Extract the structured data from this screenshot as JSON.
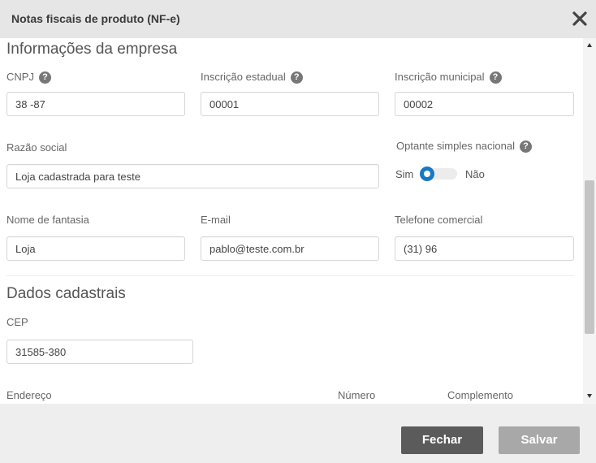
{
  "dialog": {
    "title": "Notas fiscais de produto (NF-e)",
    "close_icon": "close-icon"
  },
  "company_section": {
    "title": "Informações da empresa",
    "cnpj": {
      "label": "CNPJ",
      "value": "38                    -87"
    },
    "inscricao_estadual": {
      "label": "Inscrição estadual",
      "value": "00001"
    },
    "inscricao_municipal": {
      "label": "Inscrição municipal",
      "value": "00002"
    },
    "razao_social": {
      "label": "Razão social",
      "value": "Loja cadastrada para teste"
    },
    "optante": {
      "label": "Optante simples nacional",
      "yes": "Sim",
      "no": "Não",
      "selected": "Sim"
    },
    "nome_fantasia": {
      "label": "Nome de fantasia",
      "value": "Loja"
    },
    "email": {
      "label": "E-mail",
      "value": "pablo@teste.com.br"
    },
    "telefone": {
      "label": "Telefone comercial",
      "value": "(31)              96"
    }
  },
  "registration_section": {
    "title": "Dados cadastrais",
    "cep": {
      "label": "CEP",
      "value": "31585-380"
    },
    "endereco": {
      "label": "Endereço"
    },
    "numero": {
      "label": "Número"
    },
    "complemento": {
      "label": "Complemento"
    }
  },
  "help_glyph": "?",
  "footer": {
    "close_label": "Fechar",
    "save_label": "Salvar"
  },
  "colors": {
    "header_bg": "#e6e6e6",
    "toggle_accent": "#1778c5",
    "close_button": "#5b5b5b",
    "save_button": "#a8a8a8"
  }
}
